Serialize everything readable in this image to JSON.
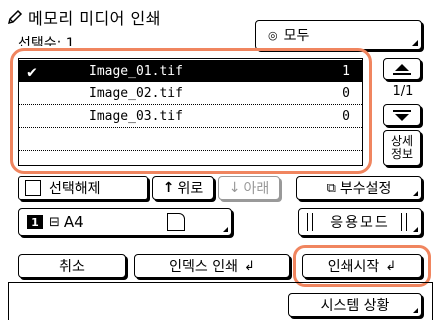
{
  "title": "메모리 미디어 인쇄",
  "selected_count_label": "선택수: 1",
  "all_dropdown": {
    "label": "모두",
    "bullet": "◎"
  },
  "files": [
    {
      "name": "Image_01.tif",
      "count": "1",
      "selected": true
    },
    {
      "name": "Image_02.tif",
      "count": "0",
      "selected": false
    },
    {
      "name": "Image_03.tif",
      "count": "0",
      "selected": false
    }
  ],
  "page_indicator": "1/1",
  "details_button": "상세\n정보",
  "deselect_label": "선택해제",
  "up_label": "위로",
  "down_label": "아래",
  "copies_label": "부수설정",
  "paper": {
    "tray_number": "1",
    "size": "A4"
  },
  "apply_mode_label": "응용모드",
  "cancel_label": "취소",
  "index_print_label": "인덱스 인쇄",
  "start_print_label": "인쇄시작",
  "system_status_label": "시스템 상황",
  "colors": {
    "highlight_ring": "#f0855f",
    "selected_row": "#000000",
    "disabled": "#999999"
  },
  "icons": {
    "title": "pencil-icon",
    "check": "checkmark-icon",
    "up": "up-arrow-icon",
    "down": "down-arrow-icon",
    "copies": "copies-icon",
    "enter": "enter-arrow-icon"
  }
}
